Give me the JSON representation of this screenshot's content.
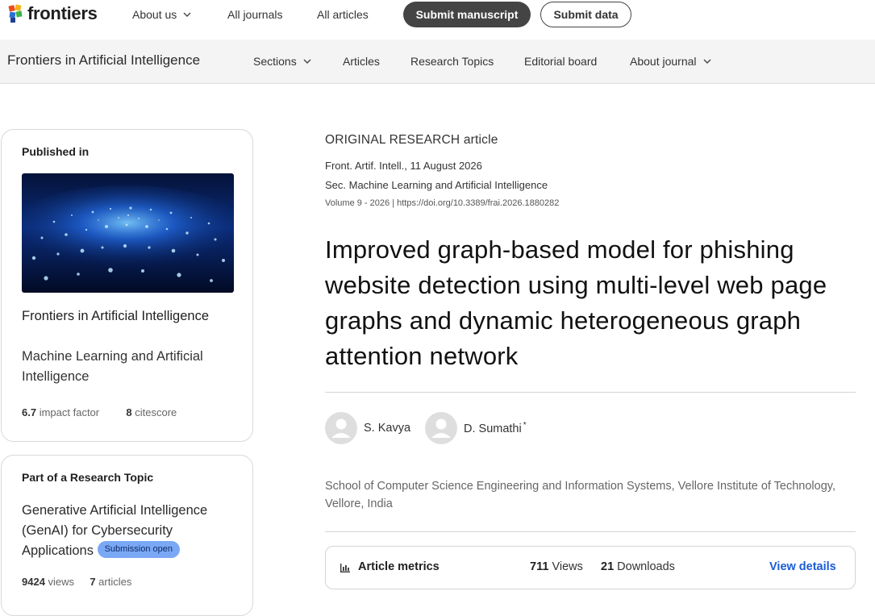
{
  "topbar": {
    "logo_text": "frontiers",
    "nav": [
      "About us",
      "All journals",
      "All articles"
    ],
    "submit_manuscript": "Submit manuscript",
    "submit_data": "Submit data"
  },
  "journalbar": {
    "title": "Frontiers in Artificial Intelligence",
    "nav": [
      "Sections",
      "Articles",
      "Research Topics",
      "Editorial board",
      "About journal"
    ]
  },
  "published_card": {
    "heading": "Published in",
    "journal": "Frontiers in Artificial Intelligence",
    "section": "Machine Learning and Artificial Intelligence",
    "impact_value": "6.7",
    "impact_label": "impact factor",
    "citescore_value": "8",
    "citescore_label": "citescore"
  },
  "topic_card": {
    "heading": "Part of a Research Topic",
    "title": "Generative Artificial Intelligence (GenAI) for Cybersecurity Applications",
    "badge": "Submission open",
    "views_value": "9424",
    "views_label": "views",
    "articles_value": "7",
    "articles_label": "articles"
  },
  "article": {
    "type": "ORIGINAL RESEARCH article",
    "citation": "Front. Artif. Intell., 11 August 2026",
    "section": "Sec. Machine Learning and Artificial Intelligence",
    "volume": "Volume 9 - 2026",
    "doi": "https://doi.org/10.3389/frai.2026.1880282",
    "title": "Improved graph-based model for phishing website detection using multi-level web page graphs and dynamic heterogeneous graph attention network",
    "authors": [
      {
        "name": "S. Kavya",
        "mark": ""
      },
      {
        "name": "D. Sumathi",
        "mark": "*"
      }
    ],
    "affiliation": "School of Computer Science Engineering and Information Systems, Vellore Institute of Technology, Vellore, India"
  },
  "metrics": {
    "title": "Article metrics",
    "views_value": "711",
    "views_label": "Views",
    "downloads_value": "21",
    "downloads_label": "Downloads",
    "details_link": "View details",
    "link_color": "#1a5bd6"
  },
  "icons": [
    "frontiers-logo-icon",
    "chevron-down-icon",
    "avatar-icon",
    "bar-chart-icon"
  ]
}
